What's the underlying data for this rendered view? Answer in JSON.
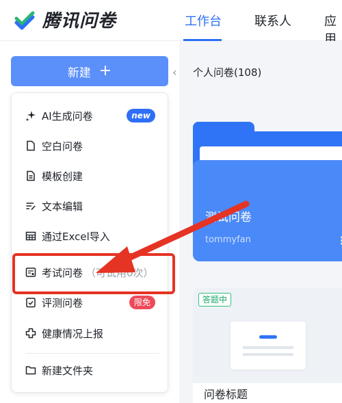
{
  "app": {
    "logo_text": "腾讯问卷",
    "nav": [
      {
        "label": "工作台",
        "active": true
      },
      {
        "label": "联系人",
        "active": false
      },
      {
        "label": "应用",
        "active": false
      }
    ]
  },
  "sidebar": {
    "new_button": {
      "label": "新建",
      "plus": "+"
    },
    "collapse_glyph": "‹",
    "menu": [
      {
        "label": "AI生成问卷",
        "icon": "sparkle-icon",
        "badge": "new"
      },
      {
        "label": "空白问卷",
        "icon": "blank-document-icon"
      },
      {
        "label": "模板创建",
        "icon": "template-document-icon"
      },
      {
        "label": "文本编辑",
        "icon": "text-edit-icon"
      },
      {
        "label": "通过Excel导入",
        "icon": "table-icon"
      },
      {
        "label": "考试问卷",
        "suffix": "（可试用0次）",
        "icon": "exam-icon"
      },
      {
        "label": "评测问卷",
        "icon": "checklist-icon",
        "badge": "限免"
      },
      {
        "label": "健康情况上报",
        "icon": "health-cross-icon"
      },
      {
        "label": "新建文件夹",
        "icon": "folder-icon"
      }
    ]
  },
  "main": {
    "section_title": "个人问卷(108)",
    "folder": {
      "title": "测试问卷",
      "owner": "tommyfan",
      "more": "⋮"
    },
    "card": {
      "status": "答题中",
      "title": "问卷标题"
    }
  },
  "colors": {
    "brand_blue": "#2e6ff6",
    "button_blue": "#5b8ff9",
    "highlight_red": "#e53324",
    "badge_red": "#ef4a5a",
    "status_green": "#16a866"
  }
}
